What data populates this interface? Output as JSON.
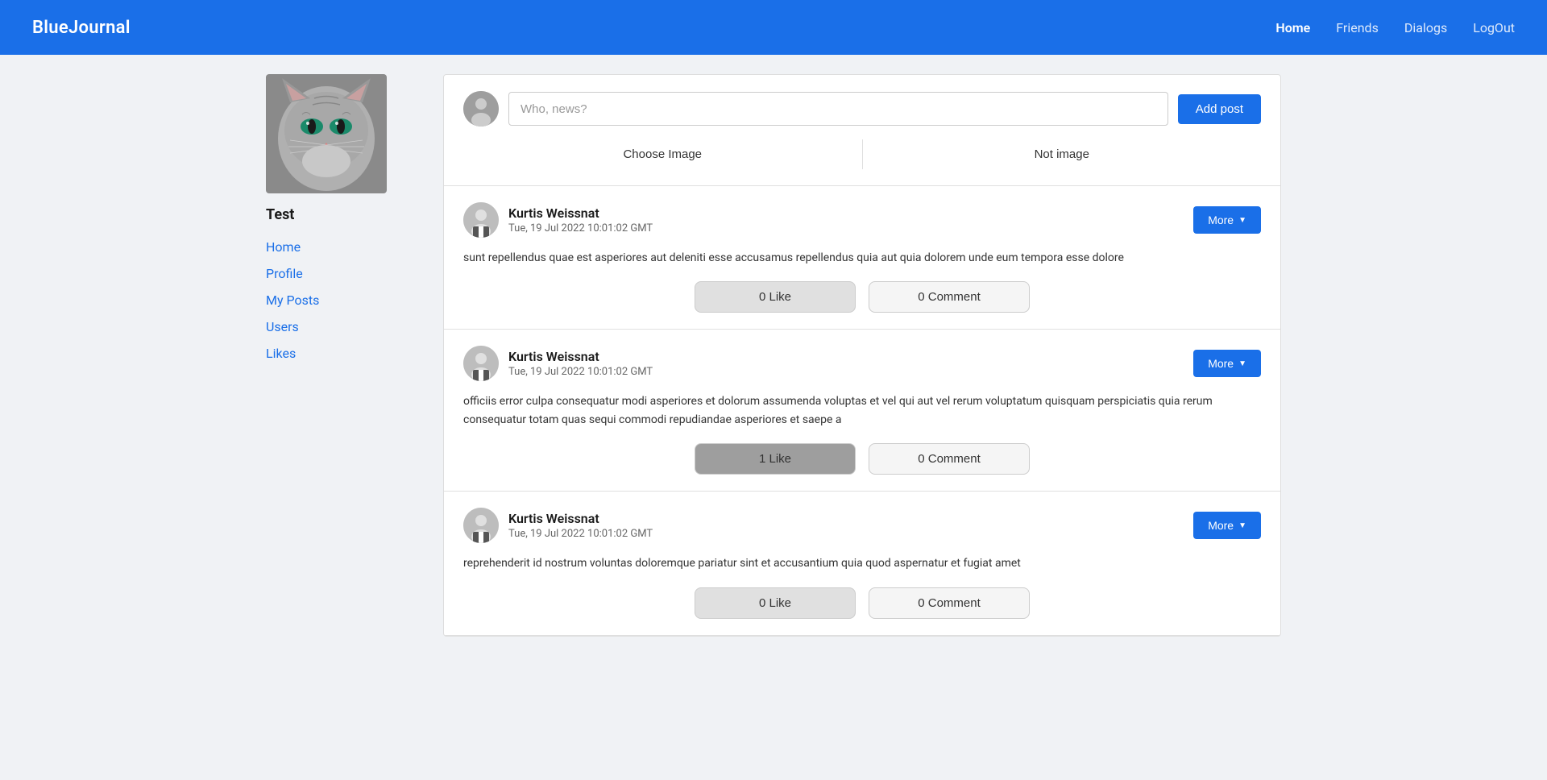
{
  "header": {
    "logo": "BlueJournal",
    "nav": [
      {
        "label": "Home",
        "active": true
      },
      {
        "label": "Friends",
        "active": false
      },
      {
        "label": "Dialogs",
        "active": false
      },
      {
        "label": "LogOut",
        "active": false
      }
    ]
  },
  "sidebar": {
    "username": "Test",
    "nav_items": [
      {
        "label": "Home"
      },
      {
        "label": "Profile"
      },
      {
        "label": "My Posts"
      },
      {
        "label": "Users"
      },
      {
        "label": "Likes"
      }
    ]
  },
  "composer": {
    "placeholder": "Who, news?",
    "add_button": "Add post",
    "choose_image": "Choose Image",
    "not_image": "Not image"
  },
  "posts": [
    {
      "author": "Kurtis Weissnat",
      "date": "Tue, 19 Jul 2022 10:01:02 GMT",
      "body": "sunt repellendus quae est asperiores aut deleniti esse accusamus repellendus quia aut quia dolorem unde eum tempora esse dolore",
      "likes": "0 Like",
      "comments": "0 Comment",
      "liked": false,
      "more_label": "More"
    },
    {
      "author": "Kurtis Weissnat",
      "date": "Tue, 19 Jul 2022 10:01:02 GMT",
      "body": "officiis error culpa consequatur modi asperiores et dolorum assumenda voluptas et vel qui aut vel rerum voluptatum quisquam perspiciatis quia rerum consequatur totam quas sequi commodi repudiandae asperiores et saepe a",
      "likes": "1 Like",
      "comments": "0 Comment",
      "liked": true,
      "more_label": "More"
    },
    {
      "author": "Kurtis Weissnat",
      "date": "Tue, 19 Jul 2022 10:01:02 GMT",
      "body": "reprehenderit id nostrum voluntas doloremque pariatur sint et accusantium quia quod aspernatur et fugiat amet",
      "likes": "0 Like",
      "comments": "0 Comment",
      "liked": false,
      "more_label": "More"
    }
  ],
  "colors": {
    "primary": "#1a6fe8",
    "text_dark": "#1a1a1a",
    "text_muted": "#666"
  }
}
